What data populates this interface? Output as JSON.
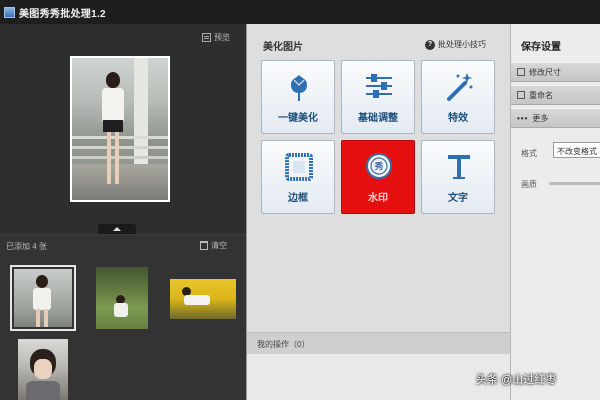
{
  "window": {
    "title": "美图秀秀批处理1.2"
  },
  "preview_panel": {
    "preview_label": "预览"
  },
  "thumbnails": {
    "added_count": "已添加 4 张",
    "clear_label": "清空",
    "items": [
      {
        "selected": true
      },
      {
        "selected": false
      },
      {
        "selected": false
      },
      {
        "selected": false
      }
    ]
  },
  "beautify": {
    "title": "美化图片",
    "tips_label": "批处理小技巧",
    "tools": [
      {
        "label": "一键美化",
        "icon": "tulip-icon",
        "active": false
      },
      {
        "label": "基础调整",
        "icon": "sliders-icon",
        "active": false
      },
      {
        "label": "特效",
        "icon": "magic-wand-icon",
        "active": false
      },
      {
        "label": "边框",
        "icon": "frame-icon",
        "active": false
      },
      {
        "label": "水印",
        "icon": "watermark-stamp-icon",
        "active": true
      },
      {
        "label": "文字",
        "icon": "text-t-icon",
        "active": false
      }
    ],
    "my_ops_label": "我的操作（0）"
  },
  "save_settings": {
    "title": "保存设置",
    "resize_label": "修改尺寸",
    "rename_label": "重命名",
    "more_label": "更多",
    "format_label": "格式",
    "format_value": "不改变格式",
    "quality_label": "画质"
  },
  "watermark_text": "头条 @山过红枣",
  "colors": {
    "active_tool": "#e50f0f",
    "tool_label": "#1e4f7d",
    "tool_border": "#a7b7c6"
  }
}
